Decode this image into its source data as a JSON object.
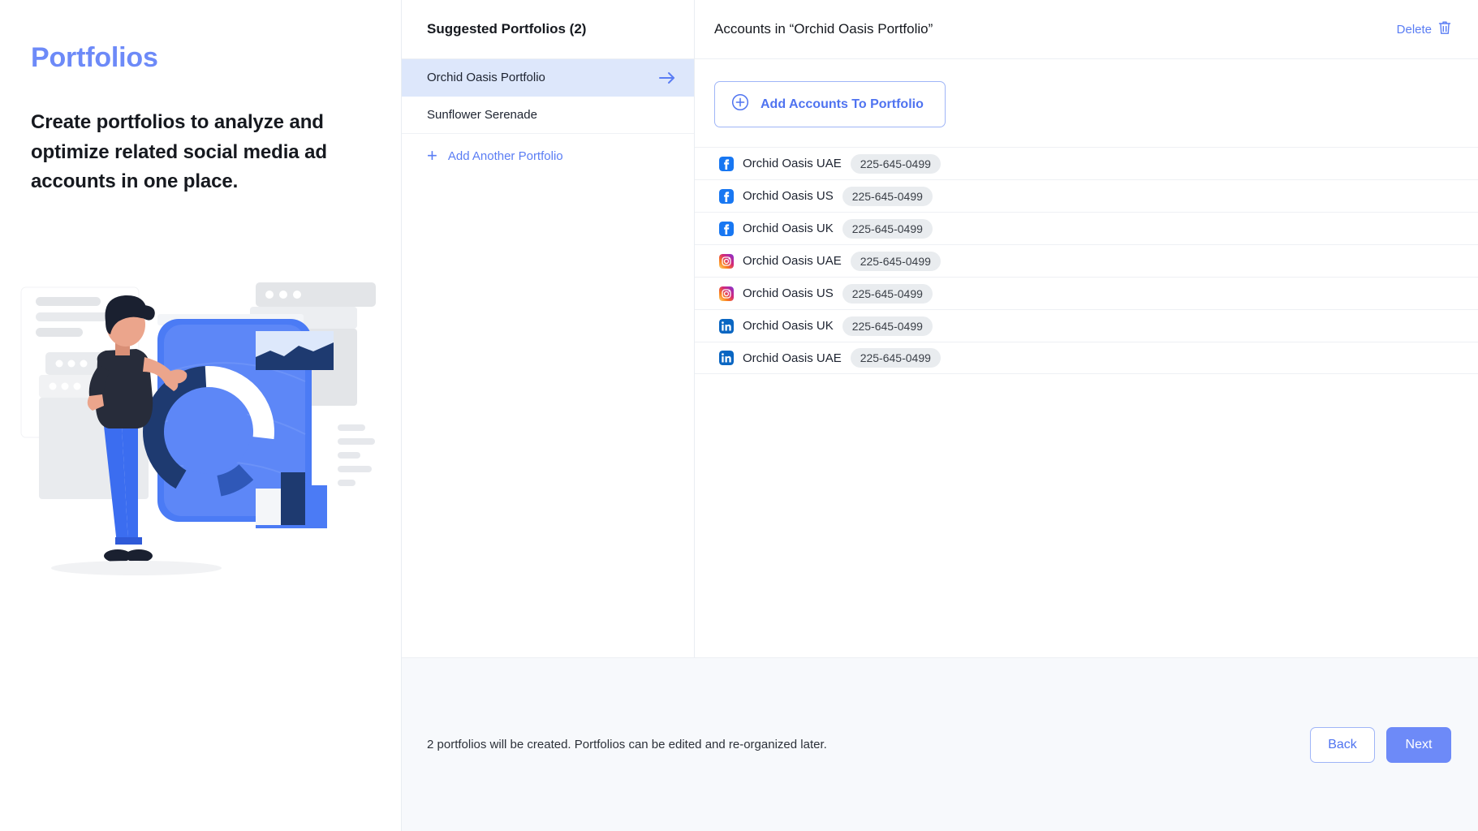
{
  "hero": {
    "title": "Portfolios",
    "subtitle": "Create portfolios to analyze and optimize related social media ad accounts in one place.",
    "illustration_name": "person-with-analytics-dashboard-illustration",
    "colors": {
      "title": "#6d8af8",
      "accent": "#5a7df4",
      "dark_blue": "#1e3a70"
    }
  },
  "suggested": {
    "heading": "Suggested Portfolios (2)",
    "items": [
      {
        "label": "Orchid Oasis Portfolio",
        "selected": true,
        "arrow": "arrow-right-icon"
      },
      {
        "label": "Sunflower Serenade",
        "selected": false,
        "arrow": ""
      }
    ],
    "add_another_label": "Add Another Portfolio",
    "add_icon": "plus-icon"
  },
  "accounts_panel": {
    "title": "Accounts in “Orchid Oasis Portfolio”",
    "delete_label": "Delete",
    "delete_icon": "trash-icon",
    "add_accounts_label": "Add Accounts To Portfolio",
    "add_accounts_icon": "plus-circle-icon",
    "rows": [
      {
        "platform": "facebook",
        "name": "Orchid Oasis UAE",
        "id": "225-645-0499"
      },
      {
        "platform": "facebook",
        "name": "Orchid Oasis US",
        "id": "225-645-0499"
      },
      {
        "platform": "facebook",
        "name": "Orchid Oasis UK",
        "id": "225-645-0499"
      },
      {
        "platform": "instagram",
        "name": "Orchid Oasis UAE",
        "id": "225-645-0499"
      },
      {
        "platform": "instagram",
        "name": "Orchid Oasis US",
        "id": "225-645-0499"
      },
      {
        "platform": "linkedin",
        "name": "Orchid Oasis UK",
        "id": "225-645-0499"
      },
      {
        "platform": "linkedin",
        "name": "Orchid Oasis UAE",
        "id": "225-645-0499"
      }
    ]
  },
  "footer": {
    "note": "2 portfolios will be created. Portfolios can be edited and re-organized later.",
    "back_label": "Back",
    "next_label": "Next"
  }
}
